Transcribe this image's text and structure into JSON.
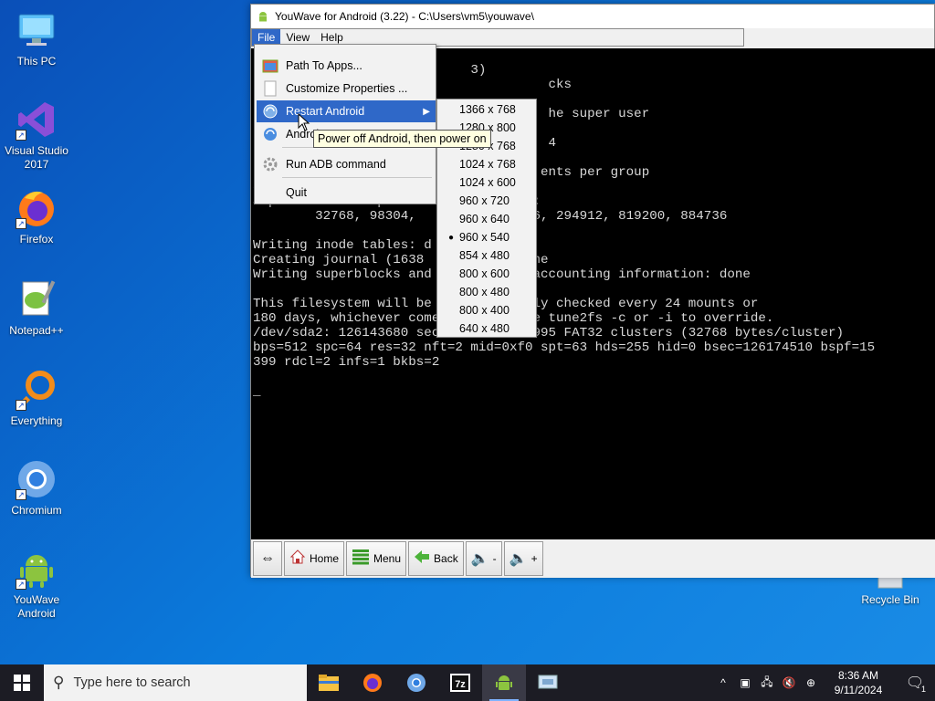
{
  "desktop": {
    "icons": [
      {
        "label": "This PC"
      },
      {
        "label": "Visual Studio 2017"
      },
      {
        "label": "Firefox"
      },
      {
        "label": "Notepad++"
      },
      {
        "label": "Everything"
      },
      {
        "label": "Chromium"
      },
      {
        "label": "YouWave Android"
      },
      {
        "label": "Recycle Bin"
      }
    ]
  },
  "window": {
    "title": "YouWave for Android (3.22) - C:\\Users\\vm5\\youwave\\",
    "menu": [
      "File",
      "View",
      "Help"
    ]
  },
  "terminal": {
    "lines": [
      "",
      "                            3)",
      "                                      cks",
      "",
      "                                      he super user",
      "",
      "                                      4",
      "",
      "                                     ents per group",
      "8112 inodes per group",
      "Superblock backups stor             :",
      "        32768, 98304,               6, 294912, 819200, 884736",
      "",
      "Writing inode tables: d",
      "Creating journal (1638              ne",
      "Writing superblocks and             accounting information: done",
      "",
      "This filesystem will be             ly checked every 24 mounts or",
      "180 days, whichever comes first.  Use tune2fs -c or -i to override.",
      "/dev/sda2: 126143680 sectors in 1970995 FAT32 clusters (32768 bytes/cluster)",
      "bps=512 spc=64 res=32 nft=2 mid=0xf0 spt=63 hds=255 hid=0 bsec=126174510 bspf=15",
      "399 rdcl=2 infs=1 bkbs=2",
      "",
      "_"
    ]
  },
  "file_menu": {
    "items": [
      {
        "label": "Path To Apps..."
      },
      {
        "label": "Customize Properties ..."
      },
      {
        "label": "Restart Android"
      },
      {
        "label": "Androi"
      },
      {
        "label": "Run ADB command"
      },
      {
        "label": "Quit"
      }
    ]
  },
  "resolution_menu": {
    "items": [
      "1366 x 768",
      "1280 x 800",
      "1280 x 768",
      "1024 x 768",
      "1024 x 600",
      "960 x 720",
      "960 x 640",
      "960 x 540",
      "854 x 480",
      "800 x 600",
      "800 x 480",
      "800 x 400",
      "640 x 480"
    ],
    "selected": "960 x 540"
  },
  "tooltip": "Power off Android, then power on",
  "toolbar": {
    "home": "Home",
    "menu": "Menu",
    "back": "Back",
    "vol_down": "-",
    "vol_up": "+"
  },
  "taskbar": {
    "search_placeholder": "Type here to search",
    "time": "8:36 AM",
    "date": "9/11/2024",
    "notification_count": "1"
  }
}
